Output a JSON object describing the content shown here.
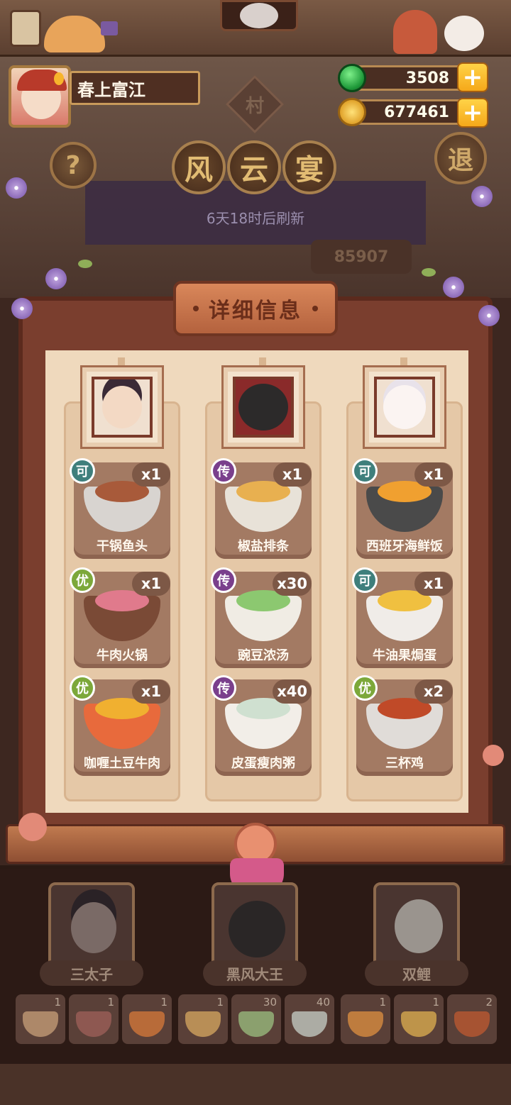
{
  "player": {
    "name": "春上富江"
  },
  "currency": {
    "jade": "3508",
    "coins": "677461"
  },
  "header": {
    "village": "村",
    "title_chars": [
      "风",
      "云",
      "宴"
    ],
    "help_symbol": "?",
    "exit_label": "退",
    "refresh_text": "6天18时后刷新",
    "score": "85907"
  },
  "modal": {
    "title": "详细信息",
    "columns": [
      {
        "dishes": [
          {
            "grade": "可",
            "grade_class": "g-ke",
            "qty": "x1",
            "name": "干锅鱼头",
            "bowl": "#d8d4d0",
            "food": "#a85a3a"
          },
          {
            "grade": "优",
            "grade_class": "g-you",
            "qty": "x1",
            "name": "牛肉火锅",
            "bowl": "#7a4a36",
            "food": "#e07a8c"
          },
          {
            "grade": "优",
            "grade_class": "g-you",
            "qty": "x1",
            "name": "咖喱土豆牛肉",
            "bowl": "#e86a3c",
            "food": "#f0b030"
          }
        ]
      },
      {
        "dishes": [
          {
            "grade": "传",
            "grade_class": "g-chuan",
            "qty": "x1",
            "name": "椒盐排条",
            "bowl": "#e8e2d8",
            "food": "#e8b050"
          },
          {
            "grade": "传",
            "grade_class": "g-chuan",
            "qty": "x30",
            "name": "豌豆浓汤",
            "bowl": "#f0ece4",
            "food": "#8cc870"
          },
          {
            "grade": "传",
            "grade_class": "g-chuan",
            "qty": "x40",
            "name": "皮蛋瘦肉粥",
            "bowl": "#f2eee8",
            "food": "#cfe0d0"
          }
        ]
      },
      {
        "dishes": [
          {
            "grade": "可",
            "grade_class": "g-ke",
            "qty": "x1",
            "name": "西班牙海鲜饭",
            "bowl": "#4a4a4a",
            "food": "#f0a030"
          },
          {
            "grade": "可",
            "grade_class": "g-ke",
            "qty": "x1",
            "name": "牛油果焗蛋",
            "bowl": "#f0ece8",
            "food": "#f0c040"
          },
          {
            "grade": "优",
            "grade_class": "g-you",
            "qty": "x2",
            "name": "三杯鸡",
            "bowl": "#e0dcd8",
            "food": "#c04a28"
          }
        ]
      }
    ]
  },
  "chef_tabs": [
    {
      "name": "三太子"
    },
    {
      "name": "黑风大王"
    },
    {
      "name": "双鲤"
    }
  ],
  "tray": [
    {
      "count": "1",
      "color": "#c9a07a"
    },
    {
      "count": "1",
      "color": "#a0605a"
    },
    {
      "count": "1",
      "color": "#d87a3a"
    },
    {
      "count": "1",
      "color": "#d8a860"
    },
    {
      "count": "30",
      "color": "#9cc080"
    },
    {
      "count": "40",
      "color": "#c8d0c8"
    },
    {
      "count": "1",
      "color": "#e09040"
    },
    {
      "count": "1",
      "color": "#e0b050"
    },
    {
      "count": "2",
      "color": "#c05a30"
    }
  ]
}
